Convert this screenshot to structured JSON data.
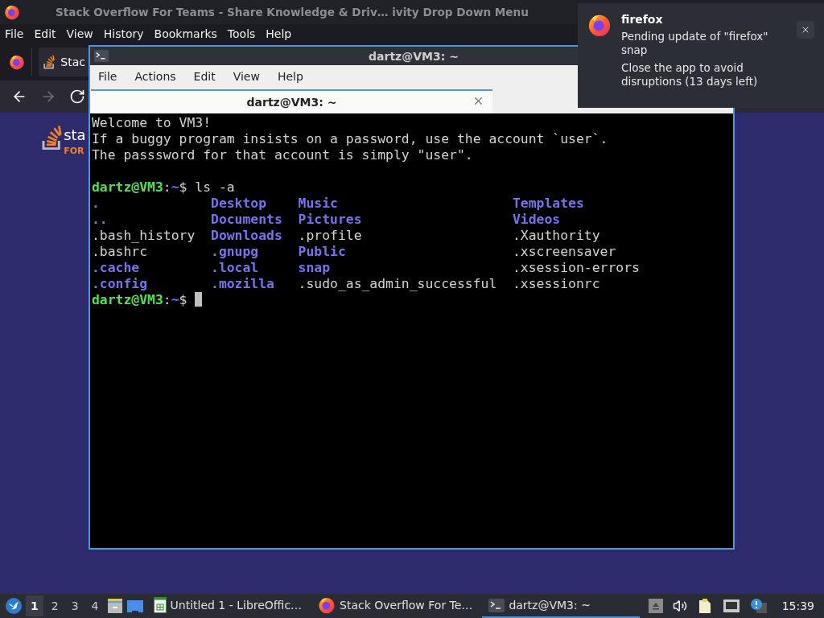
{
  "browser": {
    "title": "Stack Overflow For Teams - Share Knowledge & Driv… ivity Drop Down Menu",
    "menu": [
      "File",
      "Edit",
      "View",
      "History",
      "Bookmarks",
      "Tools",
      "Help"
    ],
    "tab": {
      "label": "Stac"
    },
    "nav": [
      {
        "kind": "back",
        "disabled": false
      },
      {
        "kind": "forward",
        "disabled": true
      },
      {
        "kind": "reload",
        "disabled": false
      }
    ],
    "logo": {
      "word": "sta",
      "tag": "FOR"
    }
  },
  "terminal": {
    "title": "dartz@VM3: ~",
    "menu": [
      "File",
      "Actions",
      "Edit",
      "View",
      "Help"
    ],
    "tabs": [
      {
        "label": "dartz@VM3: ~",
        "selected": true
      }
    ],
    "output": [
      "Welcome to VM3!",
      "If a buggy program insists on a password, use the account `user`.",
      "The passsword for that account is simply \"user\"."
    ],
    "command": {
      "user_host": "dartz@VM3",
      "sep": ":",
      "path": "~",
      "symbol": "$",
      "text": "ls -a"
    },
    "listing": [
      [
        {
          "name": ".",
          "kind": "dir"
        },
        {
          "name": "..",
          "kind": "dir"
        },
        {
          "name": ".bash_history",
          "kind": "file"
        },
        {
          "name": ".bashrc",
          "kind": "file"
        },
        {
          "name": ".cache",
          "kind": "dir"
        },
        {
          "name": ".config",
          "kind": "dir"
        }
      ],
      [
        {
          "name": "Desktop",
          "kind": "dir"
        },
        {
          "name": "Documents",
          "kind": "dir"
        },
        {
          "name": "Downloads",
          "kind": "dir"
        },
        {
          "name": ".gnupg",
          "kind": "dir"
        },
        {
          "name": ".local",
          "kind": "dir"
        },
        {
          "name": ".mozilla",
          "kind": "dir"
        }
      ],
      [
        {
          "name": "Music",
          "kind": "dir"
        },
        {
          "name": "Pictures",
          "kind": "dir"
        },
        {
          "name": ".profile",
          "kind": "file"
        },
        {
          "name": "Public",
          "kind": "dir"
        },
        {
          "name": "snap",
          "kind": "dir"
        },
        {
          "name": ".sudo_as_admin_successful",
          "kind": "file"
        }
      ],
      [
        {
          "name": "Templates",
          "kind": "dir"
        },
        {
          "name": "Videos",
          "kind": "dir"
        },
        {
          "name": ".Xauthority",
          "kind": "file"
        },
        {
          "name": ".xscreensaver",
          "kind": "file"
        },
        {
          "name": ".xsession-errors",
          "kind": "file"
        },
        {
          "name": ".xsessionrc",
          "kind": "file"
        }
      ]
    ],
    "prompt": {
      "user_host": "dartz@VM3",
      "sep": ":",
      "path": "~",
      "symbol": "$"
    }
  },
  "notification": {
    "app": "firefox",
    "lines": [
      "Pending update of \"firefox\" snap",
      "Close the app to avoid disruptions (13 days left)"
    ]
  },
  "taskbar": {
    "workspaces": [
      {
        "label": "1",
        "selected": true
      },
      {
        "label": "2",
        "selected": false
      },
      {
        "label": "3",
        "selected": false
      },
      {
        "label": "4",
        "selected": false
      }
    ],
    "tasks": [
      {
        "label": "Untitled 1 - LibreOffic…",
        "kind": "calc",
        "selected": false
      },
      {
        "label": "Stack Overflow For Te…",
        "kind": "firefox",
        "selected": false
      },
      {
        "label": "dartz@VM3: ~",
        "kind": "terminal",
        "selected": true
      }
    ],
    "clock": "15:39"
  }
}
